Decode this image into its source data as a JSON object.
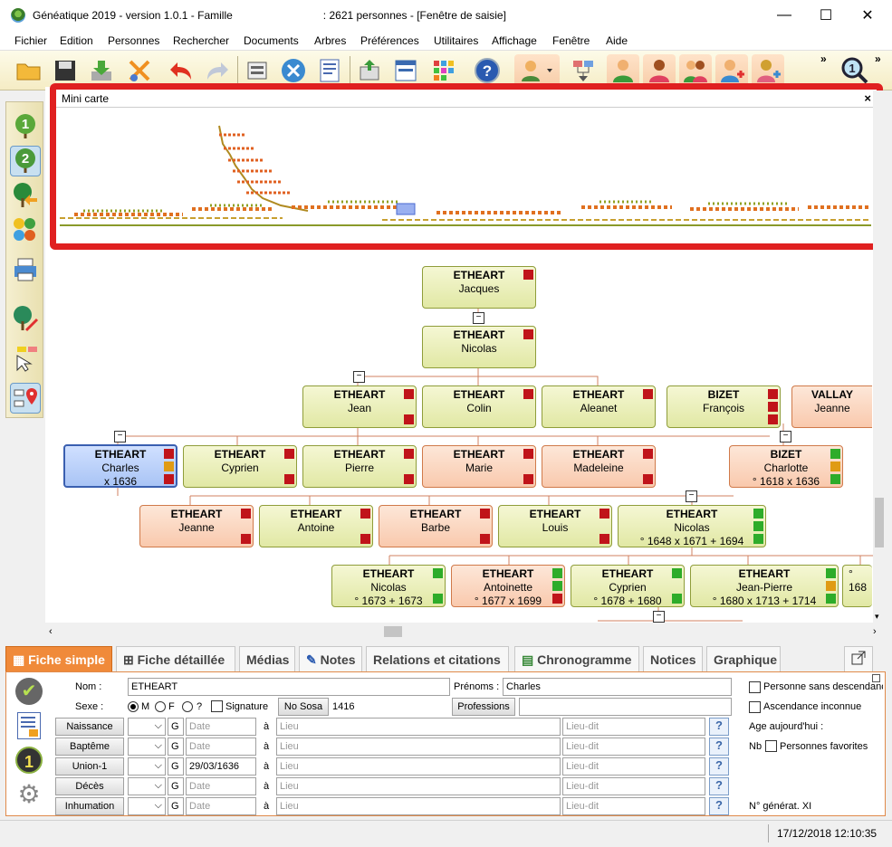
{
  "window": {
    "title": "Généatique 2019 - version 1.0.1 - Famille                              : 2621 personnes - [Fenêtre de saisie]",
    "minimize": "—",
    "maximize": "☐",
    "close": "✕"
  },
  "menu": [
    "Fichier",
    "Edition",
    "Personnes",
    "Rechercher",
    "Documents",
    "Arbres",
    "Préférences",
    "Utilitaires",
    "Affichage",
    "Fenêtre",
    "Aide"
  ],
  "toolbar": {
    "icons": [
      "open-folder-icon",
      "save-icon",
      "download-icon",
      "scissors-icon",
      "undo-icon",
      "redo-icon",
      "keyboard-icon",
      "tools-icon",
      "document-icon",
      "export-icon",
      "window-icon",
      "grid-icon",
      "help-icon",
      "person-dropdown-icon",
      "tree-link-icon",
      "man-icon",
      "woman-icon",
      "couple-icon",
      "add-man-icon",
      "add-woman-icon",
      "zoom-icon"
    ],
    "more": "»",
    "help_glyph": "?"
  },
  "sidebar": {
    "gen1": "1",
    "gen2": "2"
  },
  "minicarte": {
    "title": "Mini carte",
    "close": "×"
  },
  "tree": {
    "nodes": [
      {
        "ln": "ETHEART",
        "fn": "Jacques",
        "d": "",
        "sex": "m"
      },
      {
        "ln": "ETHEART",
        "fn": "Nicolas",
        "d": "",
        "sex": "m"
      },
      {
        "ln": "ETHEART",
        "fn": "Jean",
        "d": "",
        "sex": "m"
      },
      {
        "ln": "ETHEART",
        "fn": "Colin",
        "d": "",
        "sex": "m"
      },
      {
        "ln": "ETHEART",
        "fn": "Aleanet",
        "d": "",
        "sex": "m"
      },
      {
        "ln": "BIZET",
        "fn": "François",
        "d": "",
        "sex": "m"
      },
      {
        "ln": "VALLAY",
        "fn": "Jeanne",
        "d": "",
        "sex": "f"
      },
      {
        "ln": "ETHEART",
        "fn": "Charles",
        "d": "x 1636",
        "sex": "sel"
      },
      {
        "ln": "ETHEART",
        "fn": "Cyprien",
        "d": "",
        "sex": "m"
      },
      {
        "ln": "ETHEART",
        "fn": "Pierre",
        "d": "",
        "sex": "m"
      },
      {
        "ln": "ETHEART",
        "fn": "Marie",
        "d": "",
        "sex": "f"
      },
      {
        "ln": "ETHEART",
        "fn": "Madeleine",
        "d": "",
        "sex": "f"
      },
      {
        "ln": "BIZET",
        "fn": "Charlotte",
        "d": "° 1618   x 1636",
        "sex": "f"
      },
      {
        "ln": "ETHEART",
        "fn": "Jeanne",
        "d": "",
        "sex": "f"
      },
      {
        "ln": "ETHEART",
        "fn": "Antoine",
        "d": "",
        "sex": "m"
      },
      {
        "ln": "ETHEART",
        "fn": "Barbe",
        "d": "",
        "sex": "f"
      },
      {
        "ln": "ETHEART",
        "fn": "Louis",
        "d": "",
        "sex": "m"
      },
      {
        "ln": "ETHEART",
        "fn": "Nicolas",
        "d": "° 1648   x 1671   + 1694",
        "sex": "m"
      },
      {
        "ln": "ETHEART",
        "fn": "Nicolas",
        "d": "° 1673   + 1673",
        "sex": "m"
      },
      {
        "ln": "ETHEART",
        "fn": "Antoinette",
        "d": "° 1677   x 1699",
        "sex": "f"
      },
      {
        "ln": "ETHEART",
        "fn": "Cyprien",
        "d": "° 1678   + 1680",
        "sex": "m"
      },
      {
        "ln": "ETHEART",
        "fn": "Jean-Pierre",
        "d": "° 1680   x 1713   + 1714",
        "sex": "m"
      },
      {
        "ln": "",
        "fn": "",
        "d": "° 168",
        "sex": "m"
      }
    ],
    "toggle": "−"
  },
  "tabs": [
    "Fiche simple",
    "Fiche détaillée",
    "Médias",
    "Notes",
    "Relations et citations",
    "Chronogramme",
    "Notices",
    "Graphique"
  ],
  "form": {
    "nom_label": "Nom :",
    "nom_value": "ETHEART",
    "prenoms_label": "Prénoms :",
    "prenoms_value": "Charles",
    "sexe_label": "Sexe :",
    "sexe_m": "M",
    "sexe_f": "F",
    "sexe_u": "?",
    "signature": "Signature",
    "no_sosa_btn": "No Sosa",
    "sosa_value": "1416",
    "professions_btn": "Professions",
    "events": [
      {
        "label": "Naissance",
        "g": "G",
        "date": "",
        "a": "à"
      },
      {
        "label": "Baptême",
        "g": "G",
        "date": "",
        "a": "à"
      },
      {
        "label": "Union-1",
        "g": "G",
        "date": "29/03/1636",
        "a": "à"
      },
      {
        "label": "Décès",
        "g": "G",
        "date": "",
        "a": "à"
      },
      {
        "label": "Inhumation",
        "g": "G",
        "date": "",
        "a": "à"
      }
    ],
    "date_ph": "Date",
    "lieu_ph": "Lieu",
    "lieudit_ph": "Lieu-dit",
    "q": "?",
    "sans_desc": "Personne sans descendance",
    "asc_inconnue": "Ascendance inconnue",
    "age": "Age aujourd'hui :",
    "nb": "Nb",
    "favorites": "Personnes favorites",
    "generat": "N° générat. XI",
    "ok_glyph": "✔",
    "one_glyph": "1"
  },
  "status": {
    "datetime": "17/12/2018 12:10:35"
  }
}
